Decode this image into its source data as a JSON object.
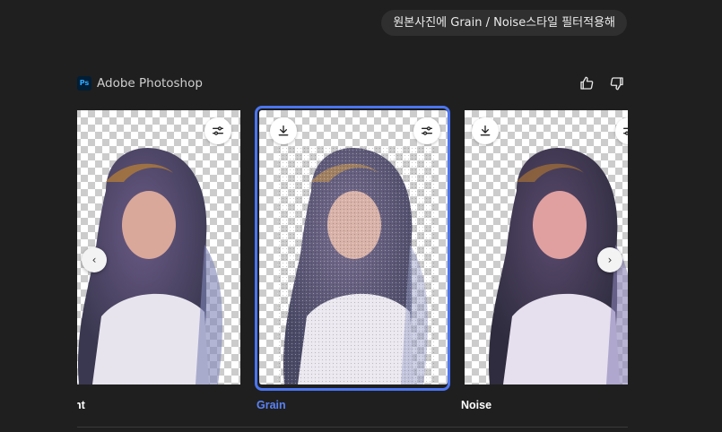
{
  "prompt": {
    "text": "원본사진에 Grain / Noise스타일 필터적용해"
  },
  "app": {
    "logo_text": "Ps",
    "name": "Adobe Photoshop"
  },
  "feedback": {
    "icons": [
      "thumbs-up-icon",
      "thumbs-down-icon"
    ]
  },
  "carousel": {
    "prev_glyph": "‹",
    "next_glyph": "›",
    "selected_index": 1,
    "cards": [
      {
        "label": "ent"
      },
      {
        "label": "Grain"
      },
      {
        "label": "Noise"
      }
    ]
  },
  "colors": {
    "accent": "#4b75f0",
    "background": "#1f1f1f",
    "bubble": "#2f2f2f"
  }
}
